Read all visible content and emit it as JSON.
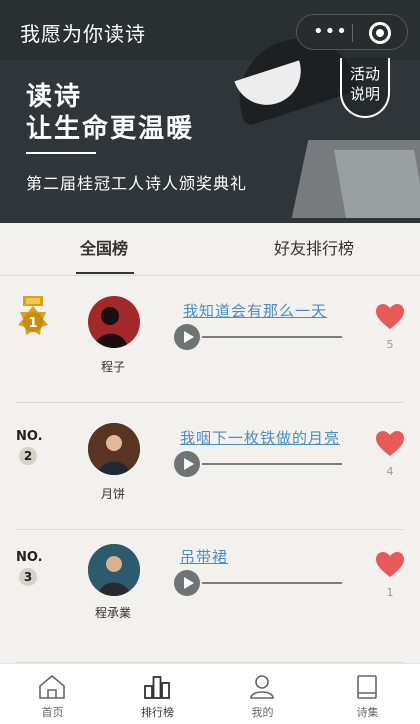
{
  "header": {
    "app_title": "我愿为你读诗",
    "capsule_dots": "•••",
    "slogan_line1": "读诗",
    "slogan_line2": "让生命更温暖",
    "subtitle": "第二届桂冠工人诗人颁奖典礼",
    "activity_line1": "活动",
    "activity_line2": "说明"
  },
  "tabs": [
    {
      "label": "全国榜",
      "active": true
    },
    {
      "label": "好友排行榜",
      "active": false
    }
  ],
  "rankings": [
    {
      "rank_label": "",
      "rank": "1",
      "name": "程子",
      "poem": "我知道会有那么一天",
      "likes": "5"
    },
    {
      "rank_label": "NO.",
      "rank": "2",
      "name": "月饼",
      "poem": "我咽下一枚铁做的月亮",
      "likes": "4"
    },
    {
      "rank_label": "NO.",
      "rank": "3",
      "name": "程承業",
      "poem": "吊带裙",
      "likes": "1"
    }
  ],
  "bottom_nav": [
    {
      "label": "首页",
      "icon": "home-icon"
    },
    {
      "label": "排行榜",
      "icon": "ranking-icon",
      "active": true
    },
    {
      "label": "我的",
      "icon": "profile-icon"
    },
    {
      "label": "诗集",
      "icon": "book-icon"
    }
  ],
  "colors": {
    "banner": "#2f3538",
    "link": "#4a8fc3",
    "heart": "#e85a5a",
    "gold": "#d9a21b",
    "background": "#f3f1ed"
  }
}
